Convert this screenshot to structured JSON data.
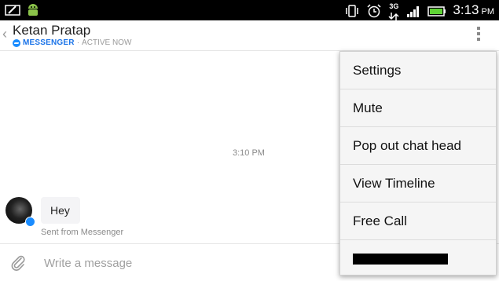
{
  "status_bar": {
    "time": "3:13",
    "ampm": "PM",
    "network": "3G",
    "icons": [
      "pen-icon",
      "android-icon",
      "vibrate-icon",
      "alarm-icon",
      "data-arrows-icon",
      "signal-icon",
      "battery-icon"
    ]
  },
  "header": {
    "title": "Ketan Pratap",
    "source": "MESSENGER",
    "separator": "·",
    "presence": "ACTIVE NOW"
  },
  "conversation": {
    "timestamp": "3:10 PM",
    "messages": [
      {
        "text": "Hey",
        "footer": "Sent from Messenger"
      }
    ]
  },
  "composer": {
    "placeholder": "Write a message"
  },
  "menu": {
    "items": [
      {
        "label": "Settings"
      },
      {
        "label": "Mute"
      },
      {
        "label": "Pop out chat head"
      },
      {
        "label": "View Timeline"
      },
      {
        "label": "Free Call"
      }
    ],
    "redacted_item": true
  },
  "colors": {
    "messenger_blue": "#1a8cff",
    "menu_bg": "#f5f5f5",
    "status_bar_bg": "#000000"
  }
}
